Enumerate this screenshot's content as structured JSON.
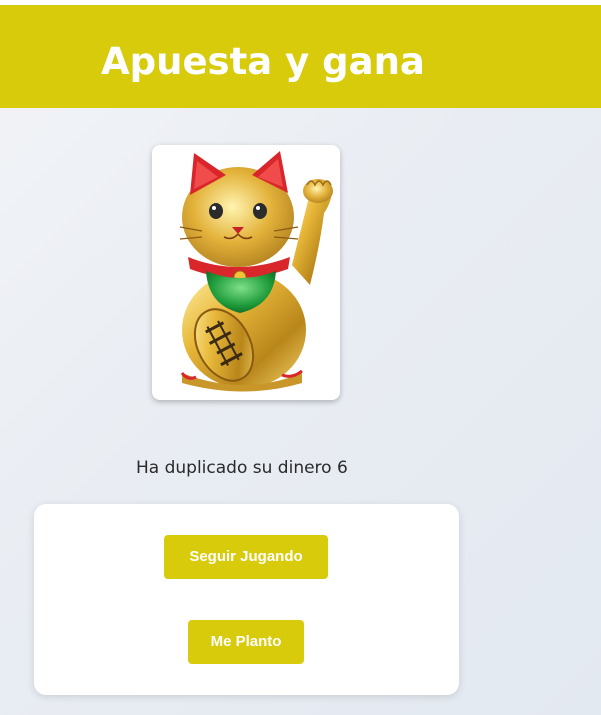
{
  "app": {
    "title": "Apuesta y gana",
    "accent_color": "#d8cb0b"
  },
  "image": {
    "icon": "lucky-cat-icon"
  },
  "result": {
    "message": "Ha duplicado su dinero 6"
  },
  "actions": {
    "continue_label": "Seguir Jugando",
    "stop_label": "Me Planto"
  }
}
